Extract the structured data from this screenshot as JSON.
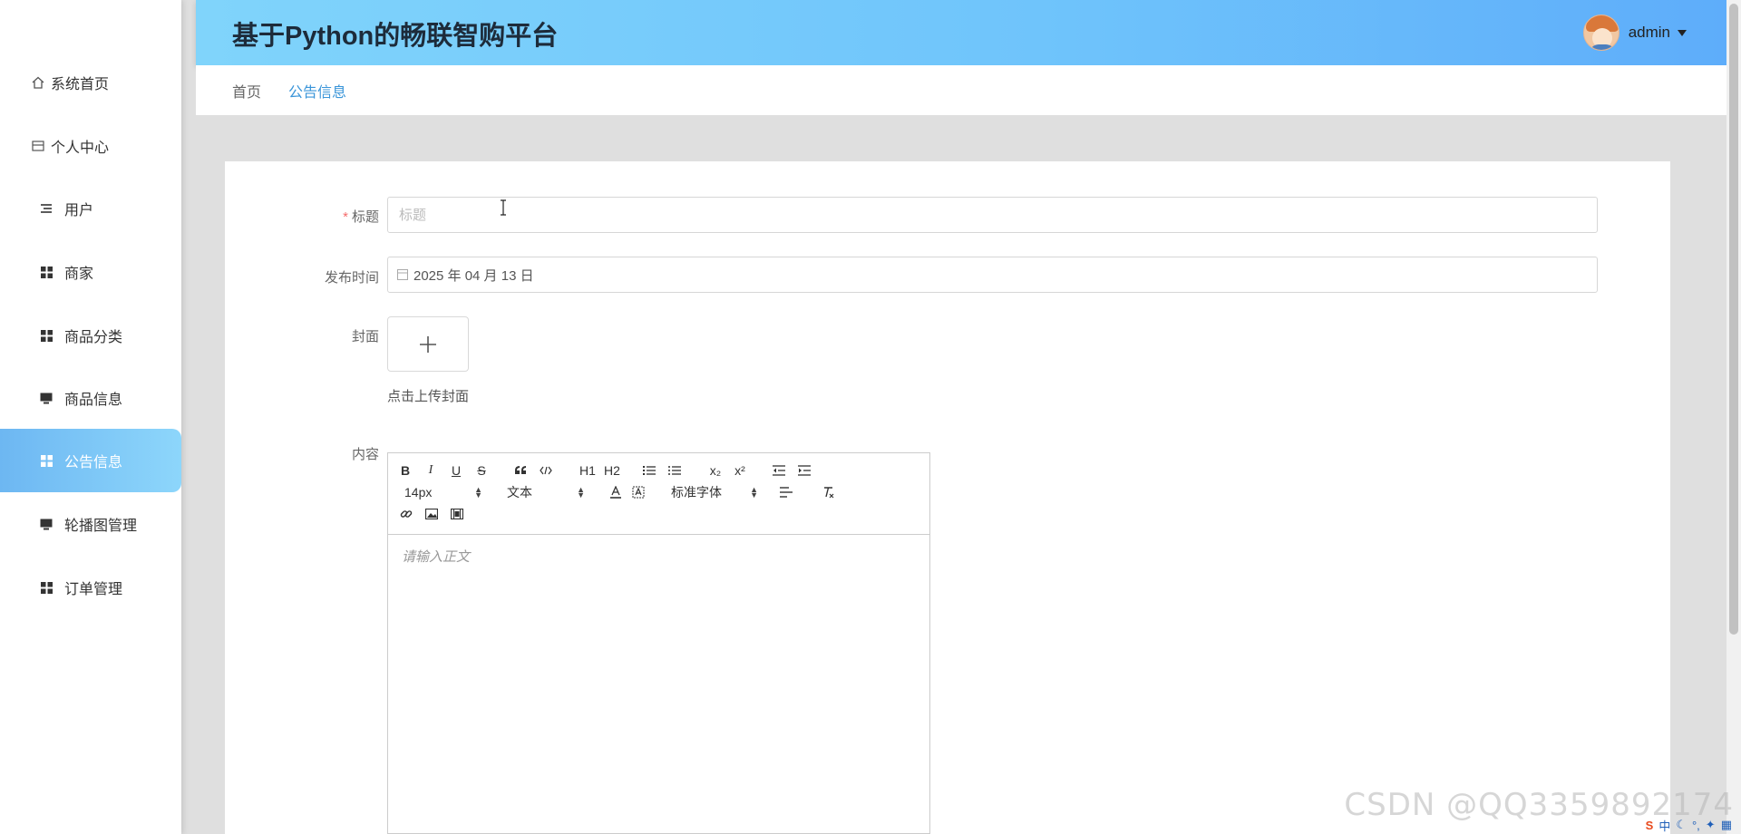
{
  "app": {
    "title": "基于Python的畅联智购平台"
  },
  "user": {
    "name": "admin"
  },
  "sidebar": {
    "items": [
      {
        "label": "系统首页",
        "icon": "home-icon"
      },
      {
        "label": "个人中心",
        "icon": "card-icon"
      },
      {
        "label": "用户",
        "icon": "list-icon"
      },
      {
        "label": "商家",
        "icon": "grid-icon"
      },
      {
        "label": "商品分类",
        "icon": "grid-icon"
      },
      {
        "label": "商品信息",
        "icon": "monitor-icon"
      },
      {
        "label": "公告信息",
        "icon": "grid-icon",
        "active": true
      },
      {
        "label": "轮播图管理",
        "icon": "monitor-icon"
      },
      {
        "label": "订单管理",
        "icon": "grid-icon"
      }
    ]
  },
  "breadcrumb": {
    "home": "首页",
    "current": "公告信息"
  },
  "form": {
    "title_label": "标题",
    "title_placeholder": "标题",
    "date_label": "发布时间",
    "date_value": "2025 年 04 月 13 日",
    "cover_label": "封面",
    "cover_hint": "点击上传封面",
    "content_label": "内容",
    "editor": {
      "font_size": "14px",
      "header": "文本",
      "font_family": "标准字体",
      "placeholder": "请输入正文",
      "buttons": {
        "bold": "B",
        "italic": "I",
        "underline": "U",
        "strike": "S",
        "h1": "H1",
        "h2": "H2",
        "sub": "x₂",
        "sup": "x²"
      }
    }
  },
  "watermark": "CSDN @QQ3359892174",
  "tray": {
    "ime_logo": "S",
    "ime_mode": "中"
  },
  "colors": {
    "accent": "#3a95d9",
    "header_start": "#80d4fb",
    "header_end": "#5eadfa",
    "required": "#f56c6c"
  }
}
